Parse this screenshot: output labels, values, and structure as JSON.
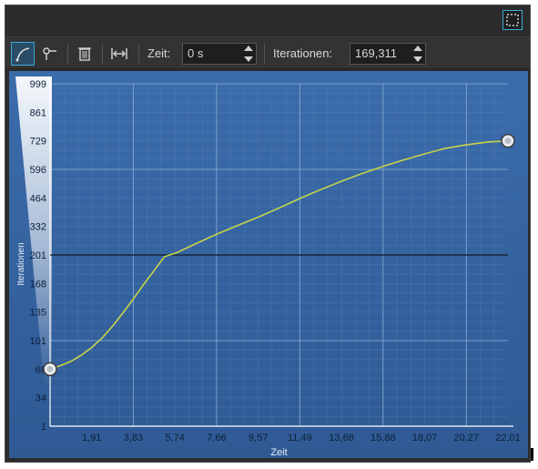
{
  "toolbar": {
    "zeit_label": "Zeit:",
    "zeit_value": "0 s",
    "iterationen_label": "Iterationen:",
    "iterationen_value": "169,311"
  },
  "chart_data": {
    "type": "line",
    "title": "",
    "xlabel": "Zeit",
    "ylabel": "Iterationen",
    "x_ticks": [
      "1,91",
      "3,83",
      "5,74",
      "7,66",
      "9,57",
      "11,49",
      "13,68",
      "15,88",
      "18,07",
      "20,27",
      "22,01"
    ],
    "y_ticks": [
      "999",
      "861",
      "729",
      "596",
      "464",
      "332",
      "201",
      "168",
      "135",
      "101",
      "68",
      "34",
      "1"
    ],
    "xlim": [
      0,
      22.01
    ],
    "series": [
      {
        "x": [
          0,
          0.5,
          1.0,
          1.5,
          2.0,
          2.5,
          3.0,
          3.5,
          4.0,
          4.5,
          5.0,
          5.5,
          6.1,
          7.0,
          8.0,
          9.0,
          10.0,
          11.0,
          12.0,
          13.0,
          14.0,
          15.0,
          16.0,
          17.0,
          18.0,
          19.0,
          20.0,
          21.0,
          22.01
        ],
        "y": [
          68,
          72,
          77,
          84,
          93,
          104,
          118,
          134,
          150,
          167,
          183,
          199,
          212,
          253,
          296,
          336,
          375,
          417,
          461,
          502,
          541,
          577,
          610,
          640,
          668,
          694,
          710,
          723,
          729
        ]
      }
    ],
    "reference_line_y": 201,
    "control_points": [
      {
        "x": 0,
        "y": 68
      },
      {
        "x": 22.01,
        "y": 729
      }
    ],
    "colors": {
      "background": "#3a6aa6",
      "line": "#c8d44a",
      "grid": "#7fa0cc"
    }
  }
}
